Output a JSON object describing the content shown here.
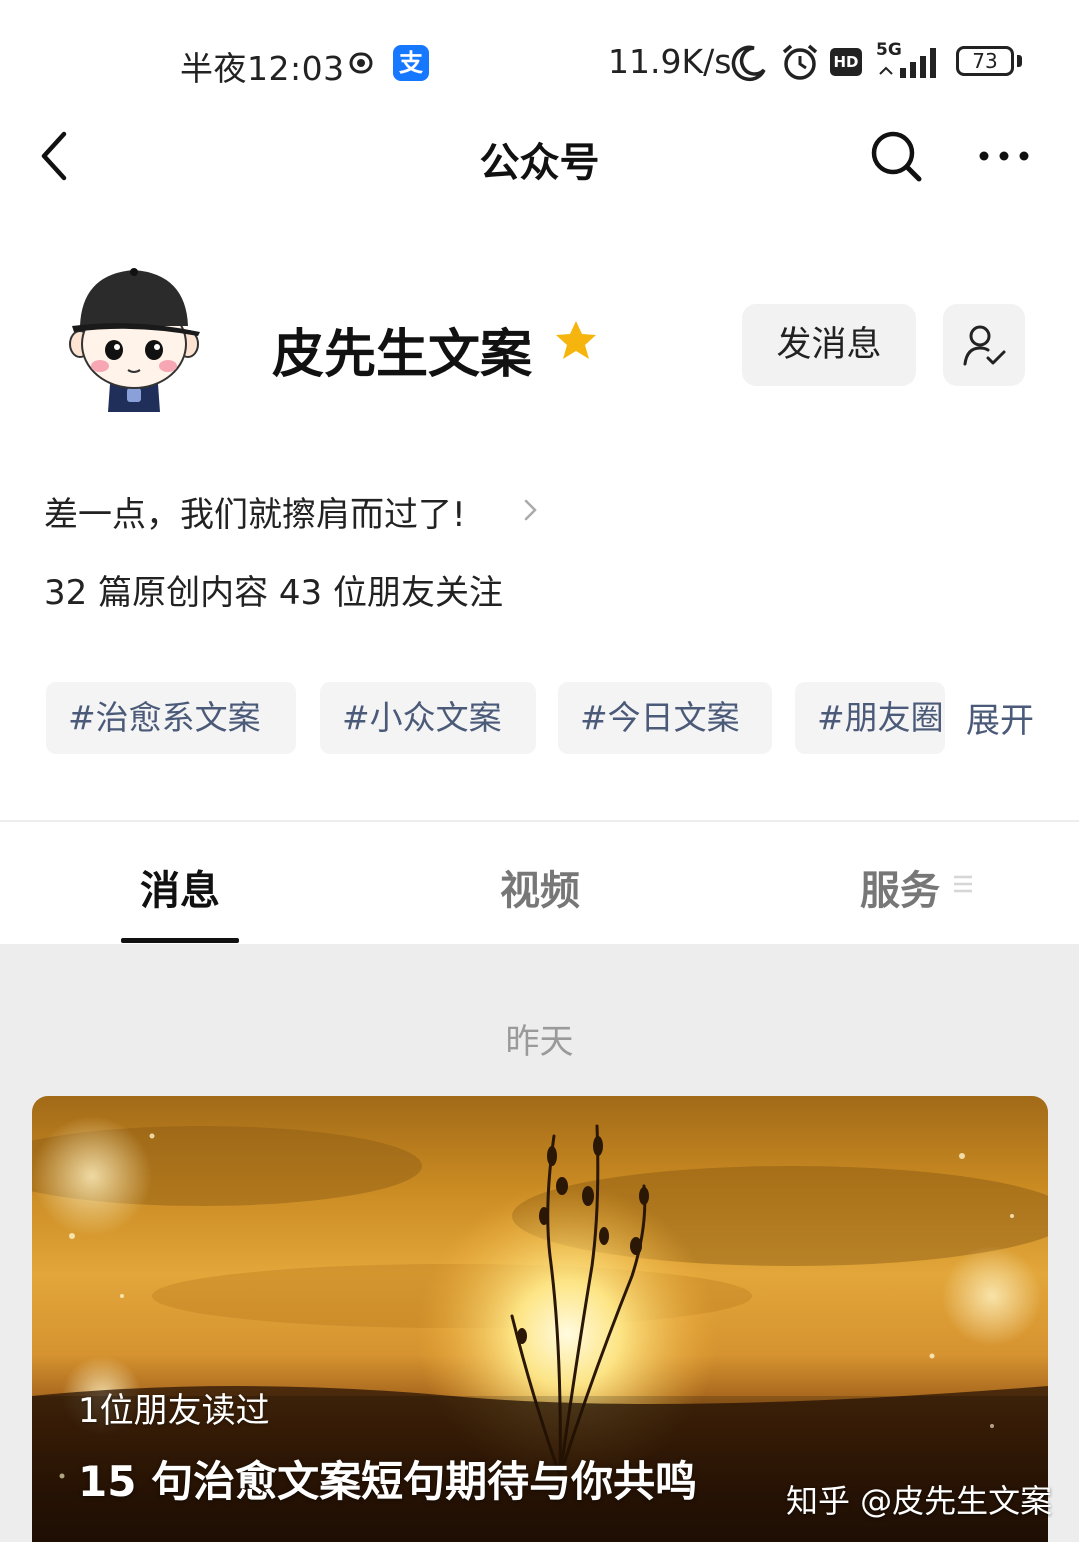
{
  "status_bar": {
    "time": "半夜12:03",
    "alipay_glyph": "支",
    "net_speed": "11.9K/s",
    "hd": "HD",
    "network": "5G",
    "battery": "73"
  },
  "nav": {
    "title": "公众号",
    "icons": [
      "back-arrow-icon",
      "search-icon",
      "more-icon"
    ]
  },
  "profile": {
    "name": "皮先生文案",
    "message_button": "发消息",
    "bio": "差一点，我们就擦肩而过了!",
    "stats": "32 篇原创内容  43 位朋友关注",
    "star_color": "#f6b40e"
  },
  "tags": {
    "items": [
      "#治愈系文案",
      "#小众文案",
      "#今日文案",
      "#朋友圈文案"
    ],
    "expand": "展开"
  },
  "tabs": {
    "items": [
      "消息",
      "视频",
      "服务"
    ],
    "active": 0
  },
  "feed": {
    "date": "昨天",
    "article": {
      "readers": "1位朋友读过",
      "title": "15 句治愈文案短句期待与你共鸣"
    },
    "watermark": "知乎 @皮先生文案"
  }
}
